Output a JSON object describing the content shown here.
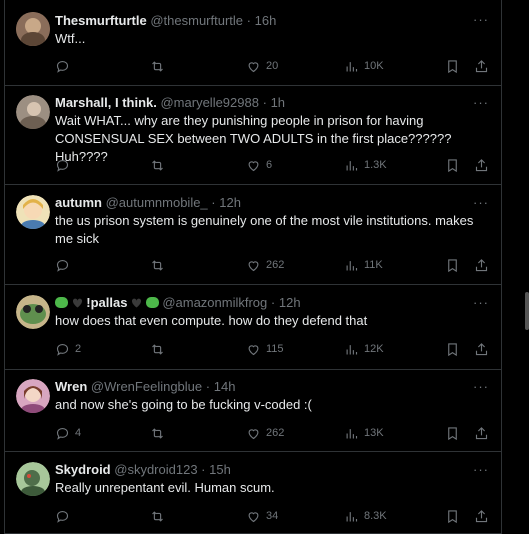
{
  "tweets": [
    {
      "name": "Thesmurfturtle",
      "handle": "@thesmurfturtle",
      "sep": "·",
      "time": "16h",
      "text": "Wtf...",
      "replies": "",
      "retweets": "",
      "likes": "20",
      "views": "10K",
      "avatar_color": "#8a6d5a"
    },
    {
      "name": "Marshall, I think.",
      "handle": "@maryelle92988",
      "sep": "·",
      "time": "1h",
      "text": "Wait WHAT... why are they punishing people in prison for having CONSENSUAL SEX between TWO ADULTS in the first place?????? Huh????",
      "replies": "",
      "retweets": "",
      "likes": "6",
      "views": "1.3K",
      "avatar_color": "#9c8f82"
    },
    {
      "name": "autumn",
      "handle": "@autumnmobile_",
      "sep": "·",
      "time": "12h",
      "text": "the us prison system is genuinely one of the most vile institutions. makes me sick",
      "replies": "",
      "retweets": "",
      "likes": "262",
      "views": "11K",
      "avatar_color": "#d8b36a"
    },
    {
      "name": "!pallas",
      "handle": "@amazonmilkfrog",
      "sep": "·",
      "time": "12h",
      "text": "how does that even compute. how do they defend that",
      "replies": "2",
      "retweets": "",
      "likes": "115",
      "views": "12K",
      "avatar_color": "#5f8f4e"
    },
    {
      "name": "Wren",
      "handle": "@WrenFeelingblue",
      "sep": "·",
      "time": "14h",
      "text": "and now she's going to be fucking v-coded :(",
      "replies": "4",
      "retweets": "",
      "likes": "262",
      "views": "13K",
      "avatar_color": "#b7769a"
    },
    {
      "name": "Skydroid",
      "handle": "@skydroid123",
      "sep": "·",
      "time": "15h",
      "text": "Really unrepentant evil. Human scum.",
      "replies": "",
      "retweets": "",
      "likes": "34",
      "views": "8.3K",
      "avatar_color": "#6b9a6a"
    }
  ],
  "more_label": "···",
  "colors": {
    "bg": "#000000",
    "border": "#2f3336",
    "muted": "#71767b",
    "text": "#e7e9ea"
  }
}
